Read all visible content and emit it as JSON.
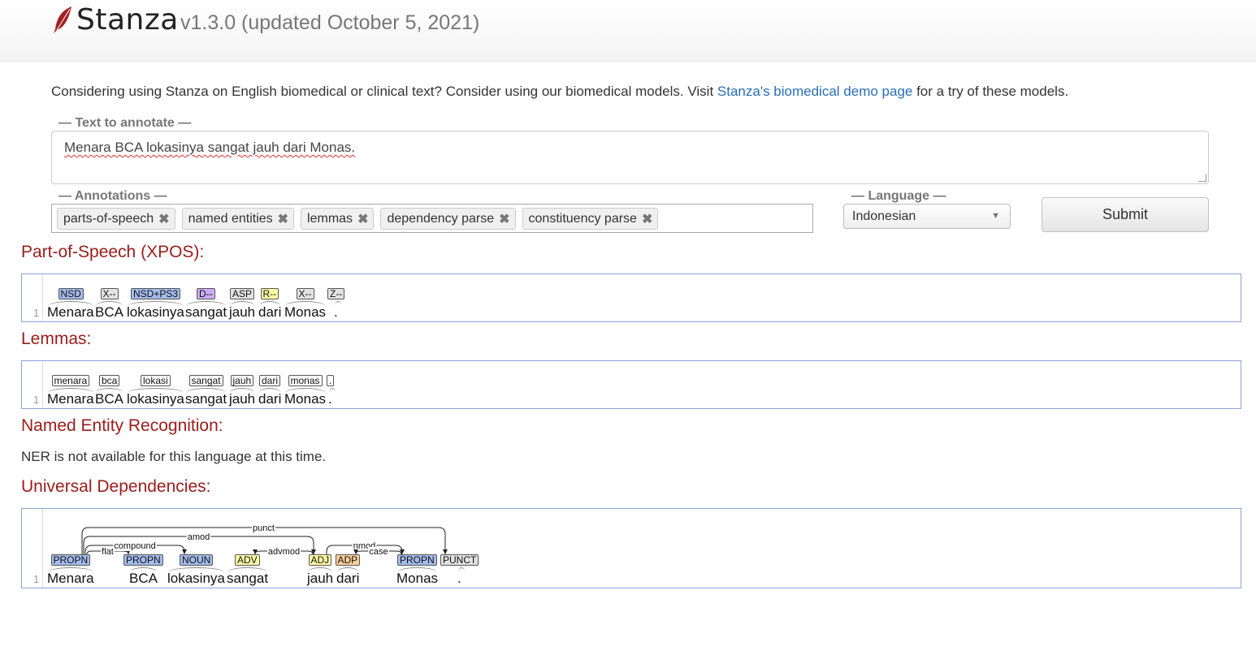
{
  "header": {
    "brand": "Stanza",
    "version": "v1.3.0 (updated October 5, 2021)",
    "logo_icon": "feather-icon",
    "logo_color": "#a32020"
  },
  "notice": {
    "before": "Considering using Stanza on English biomedical or clinical text? Consider using our biomedical models. Visit ",
    "link": "Stanza's biomedical demo page",
    "after": " for a try of these models."
  },
  "form": {
    "text_legend": "— Text to annotate —",
    "text_value": "Menara BCA lokasinya sangat jauh dari Monas.",
    "annotations_legend": "— Annotations —",
    "annotations": [
      "parts-of-speech",
      "named entities",
      "lemmas",
      "dependency parse",
      "constituency parse"
    ],
    "remove_glyph": "✖",
    "language_legend": "— Language —",
    "language_value": "Indonesian",
    "submit_label": "Submit"
  },
  "sections": {
    "pos_title": "Part-of-Speech (XPOS):",
    "lemma_title": "Lemmas:",
    "ner_title": "Named Entity Recognition:",
    "ner_message": "NER is not available for this language at this time.",
    "ud_title": "Universal Dependencies:"
  },
  "line_number": "1",
  "tokens": [
    "Menara",
    "BCA",
    "lokasinya",
    "sangat",
    "jauh",
    "dari",
    "Monas",
    "."
  ],
  "xpos": [
    {
      "tag": "NSD",
      "color": "#a4bced"
    },
    {
      "tag": "X--",
      "color": "#e3e3e3"
    },
    {
      "tag": "NSD+PS3",
      "color": "#a4bced"
    },
    {
      "tag": "D--",
      "color": "#ccadf6"
    },
    {
      "tag": "ASP",
      "color": "#e3e3e3"
    },
    {
      "tag": "R--",
      "color": "#fffda8"
    },
    {
      "tag": "X--",
      "color": "#e3e3e3"
    },
    {
      "tag": "Z--",
      "color": "#e3e3e3"
    }
  ],
  "lemmas": [
    "menara",
    "bca",
    "lokasi",
    "sangat",
    "jauh",
    "dari",
    "monas",
    "."
  ],
  "lemma_color": "#ffffff",
  "upos": [
    {
      "tag": "PROPN",
      "color": "#a4bced"
    },
    {
      "tag": "PROPN",
      "color": "#a4bced"
    },
    {
      "tag": "NOUN",
      "color": "#a4bced"
    },
    {
      "tag": "ADV",
      "color": "#fffda8"
    },
    {
      "tag": "ADJ",
      "color": "#fffda8"
    },
    {
      "tag": "ADP",
      "color": "#fecf9a"
    },
    {
      "tag": "PROPN",
      "color": "#a4bced"
    },
    {
      "tag": "PUNCT",
      "color": "#e3e3e3"
    }
  ],
  "dependencies": [
    {
      "head": 0,
      "dep": 1,
      "label": "flat"
    },
    {
      "head": 0,
      "dep": 2,
      "label": "compound"
    },
    {
      "head": 0,
      "dep": 4,
      "label": "amod"
    },
    {
      "head": 0,
      "dep": 7,
      "label": "punct"
    },
    {
      "head": 4,
      "dep": 3,
      "label": "advmod"
    },
    {
      "head": 4,
      "dep": 6,
      "label": "nmod"
    },
    {
      "head": 6,
      "dep": 5,
      "label": "case"
    }
  ]
}
